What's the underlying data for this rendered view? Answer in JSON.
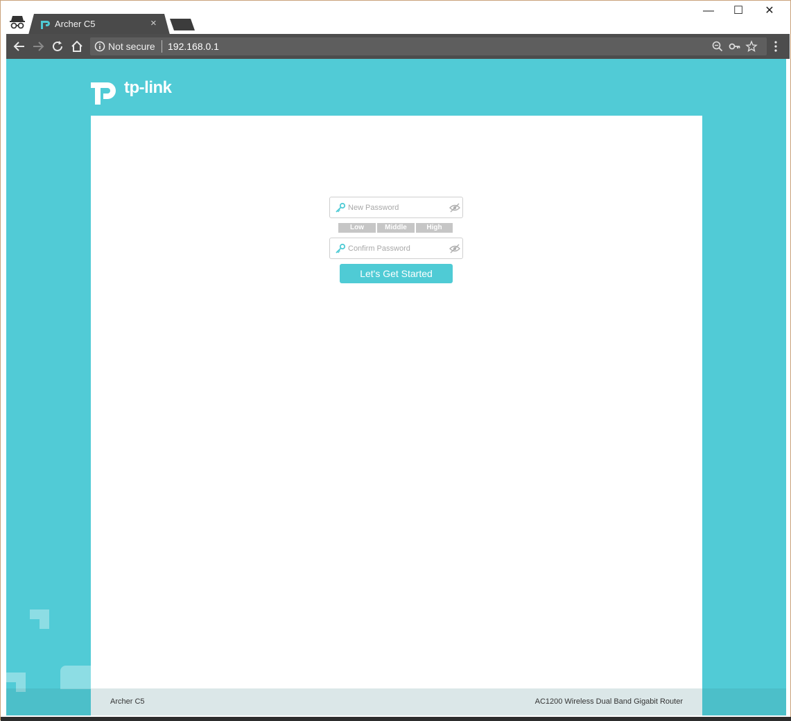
{
  "browser": {
    "tab_title": "Archer C5",
    "security_label": "Not secure",
    "url": "192.168.0.1",
    "window_controls": {
      "minimize": "—",
      "maximize": "☐",
      "close": "✕"
    },
    "tab_close": "×"
  },
  "page": {
    "brand": "tp-link",
    "new_password_placeholder": "New Password",
    "confirm_password_placeholder": "Confirm Password",
    "strength_levels": [
      "Low",
      "Middle",
      "High"
    ],
    "start_button": "Let's Get Started",
    "footer_model": "Archer C5",
    "footer_description": "AC1200 Wireless Dual Band Gigabit Router"
  },
  "colors": {
    "brand_teal": "#51cbd6",
    "button_teal": "#4fcbd5",
    "strength_gray": "#c6c6c6",
    "toolbar": "#4d4d4d"
  },
  "icons": {
    "incognito": "incognito-icon",
    "favicon": "tplink-favicon-icon",
    "back": "back-arrow-icon",
    "forward": "forward-arrow-icon",
    "reload": "reload-icon",
    "home": "home-icon",
    "info": "info-icon",
    "zoom": "zoom-out-icon",
    "key": "key-icon",
    "star": "star-icon",
    "menu": "more-vert-icon",
    "eye": "eye-hidden-icon"
  }
}
